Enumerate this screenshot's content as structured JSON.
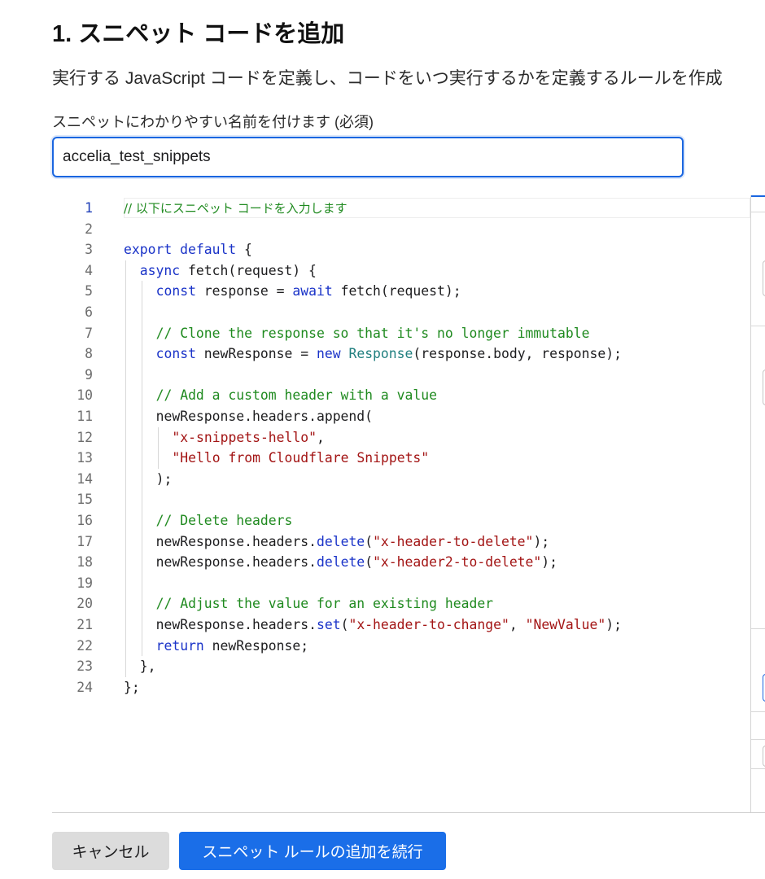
{
  "step_title": "1. スニペット コードを追加",
  "description": "実行する JavaScript コードを定義し、コードをいつ実行するかを定義するルールを作成",
  "name_field": {
    "label": "スニペットにわかりやすい名前を付けます (必須)",
    "value": "accelia_test_snippets"
  },
  "editor": {
    "active_line": 1,
    "lines": [
      {
        "n": "1",
        "indent": 0,
        "parts": [
          {
            "t": "// 以下にスニペット コードを入力します",
            "c": "cm cm-jp"
          }
        ]
      },
      {
        "n": "2",
        "indent": 0,
        "parts": []
      },
      {
        "n": "3",
        "indent": 0,
        "parts": [
          {
            "t": "export",
            "c": "kw"
          },
          {
            "t": " "
          },
          {
            "t": "default",
            "c": "kw"
          },
          {
            "t": " {"
          }
        ]
      },
      {
        "n": "4",
        "indent": 1,
        "parts": [
          {
            "t": "async",
            "c": "kw"
          },
          {
            "t": " fetch(request) {"
          }
        ]
      },
      {
        "n": "5",
        "indent": 2,
        "parts": [
          {
            "t": "const",
            "c": "kw"
          },
          {
            "t": " response = "
          },
          {
            "t": "await",
            "c": "kw"
          },
          {
            "t": " fetch(request);"
          }
        ]
      },
      {
        "n": "6",
        "indent": 0,
        "parts": []
      },
      {
        "n": "7",
        "indent": 2,
        "parts": [
          {
            "t": "// Clone the response so that it's no longer immutable",
            "c": "cm"
          }
        ]
      },
      {
        "n": "8",
        "indent": 2,
        "parts": [
          {
            "t": "const",
            "c": "kw"
          },
          {
            "t": " newResponse = "
          },
          {
            "t": "new",
            "c": "kw"
          },
          {
            "t": " "
          },
          {
            "t": "Response",
            "c": "ty"
          },
          {
            "t": "(response.body, response);"
          }
        ]
      },
      {
        "n": "9",
        "indent": 0,
        "parts": []
      },
      {
        "n": "10",
        "indent": 2,
        "parts": [
          {
            "t": "// Add a custom header with a value",
            "c": "cm"
          }
        ]
      },
      {
        "n": "11",
        "indent": 2,
        "parts": [
          {
            "t": "newResponse.headers.append("
          }
        ]
      },
      {
        "n": "12",
        "indent": 3,
        "parts": [
          {
            "t": "\"x-snippets-hello\"",
            "c": "st"
          },
          {
            "t": ","
          }
        ]
      },
      {
        "n": "13",
        "indent": 3,
        "parts": [
          {
            "t": "\"Hello from Cloudflare Snippets\"",
            "c": "st"
          }
        ]
      },
      {
        "n": "14",
        "indent": 2,
        "parts": [
          {
            "t": ");"
          }
        ]
      },
      {
        "n": "15",
        "indent": 0,
        "parts": []
      },
      {
        "n": "16",
        "indent": 2,
        "parts": [
          {
            "t": "// Delete headers",
            "c": "cm"
          }
        ]
      },
      {
        "n": "17",
        "indent": 2,
        "parts": [
          {
            "t": "newResponse.headers."
          },
          {
            "t": "delete",
            "c": "kw"
          },
          {
            "t": "("
          },
          {
            "t": "\"x-header-to-delete\"",
            "c": "st"
          },
          {
            "t": ");"
          }
        ]
      },
      {
        "n": "18",
        "indent": 2,
        "parts": [
          {
            "t": "newResponse.headers."
          },
          {
            "t": "delete",
            "c": "kw"
          },
          {
            "t": "("
          },
          {
            "t": "\"x-header2-to-delete\"",
            "c": "st"
          },
          {
            "t": ");"
          }
        ]
      },
      {
        "n": "19",
        "indent": 0,
        "parts": []
      },
      {
        "n": "20",
        "indent": 2,
        "parts": [
          {
            "t": "// Adjust the value for an existing header",
            "c": "cm"
          }
        ]
      },
      {
        "n": "21",
        "indent": 2,
        "parts": [
          {
            "t": "newResponse.headers."
          },
          {
            "t": "set",
            "c": "kw"
          },
          {
            "t": "("
          },
          {
            "t": "\"x-header-to-change\"",
            "c": "st"
          },
          {
            "t": ", "
          },
          {
            "t": "\"NewValue\"",
            "c": "st"
          },
          {
            "t": ");"
          }
        ]
      },
      {
        "n": "22",
        "indent": 2,
        "parts": [
          {
            "t": "return",
            "c": "kw"
          },
          {
            "t": " newResponse;"
          }
        ]
      },
      {
        "n": "23",
        "indent": 1,
        "parts": [
          {
            "t": "},"
          }
        ]
      },
      {
        "n": "24",
        "indent": 0,
        "parts": [
          {
            "t": "};"
          }
        ]
      }
    ]
  },
  "buttons": {
    "cancel": "キャンセル",
    "continue": "スニペット ルールの追加を続行"
  },
  "colors": {
    "accent": "#1a6ee8",
    "keyword": "#1a33c8",
    "comment": "#1f8a1f",
    "string": "#a31515",
    "type": "#207f7f"
  }
}
